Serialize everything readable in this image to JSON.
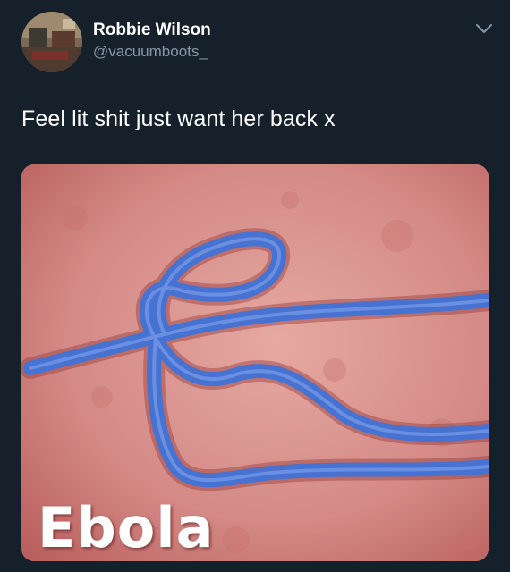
{
  "tweet": {
    "display_name": "Robbie Wilson",
    "handle": "@vacuumboots_",
    "text": "Feel lit shit just want her back x",
    "more_icon": "chevron-down-icon",
    "media": {
      "caption": "Ebola"
    }
  },
  "colors": {
    "background": "#15202b",
    "primary_text": "#ffffff",
    "secondary_text": "#8899a6",
    "virus_blue": "#4a78d6",
    "image_pink": "#d98c89"
  }
}
